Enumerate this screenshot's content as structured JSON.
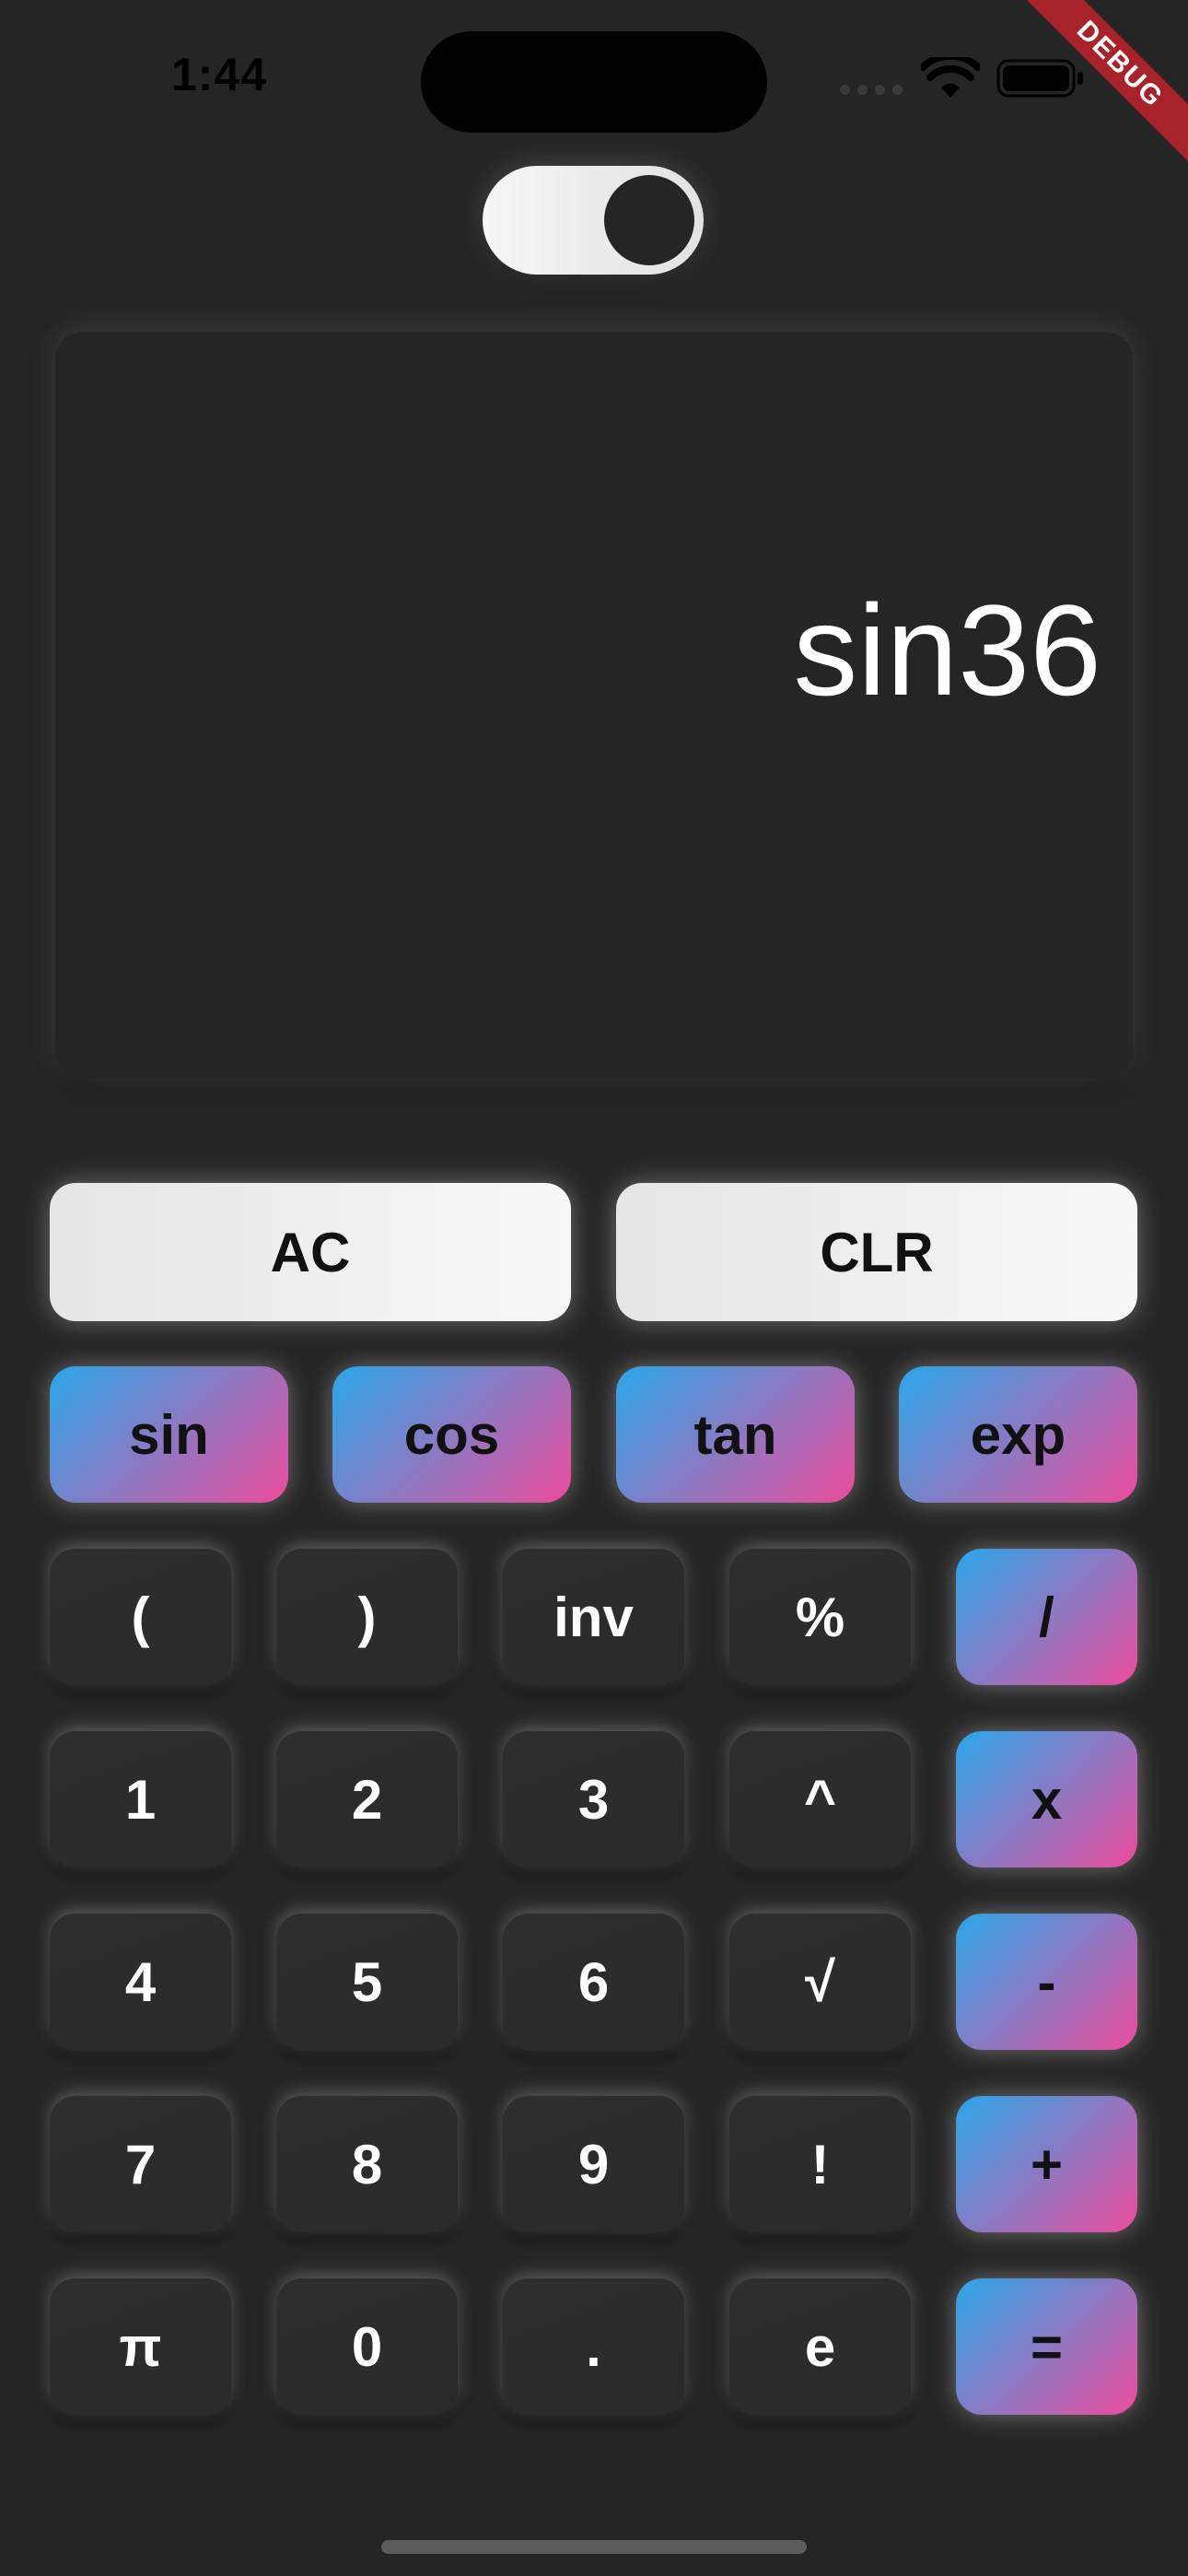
{
  "status_bar": {
    "time": "1:44"
  },
  "debug_banner": "DEBUG",
  "display": {
    "expression": "sin36"
  },
  "keys": {
    "ac": "AC",
    "clr": "CLR",
    "sin": "sin",
    "cos": "cos",
    "tan": "tan",
    "exp": "exp",
    "open_paren": "(",
    "close_paren": ")",
    "inv": "inv",
    "percent": "%",
    "divide": "/",
    "one": "1",
    "two": "2",
    "three": "3",
    "power": "^",
    "multiply": "x",
    "four": "4",
    "five": "5",
    "six": "6",
    "sqrt": "√",
    "minus": "-",
    "seven": "7",
    "eight": "8",
    "nine": "9",
    "factorial": "!",
    "plus": "+",
    "pi": "π",
    "zero": "0",
    "dot": ".",
    "e": "e",
    "equals": "="
  },
  "colors": {
    "background": "#252525",
    "gradient_start": "#2aa6e9",
    "gradient_end": "#ec4c9c",
    "light_key": "#eeeeee",
    "dark_key": "#2d2d2d"
  },
  "toggle": {
    "on": true
  }
}
